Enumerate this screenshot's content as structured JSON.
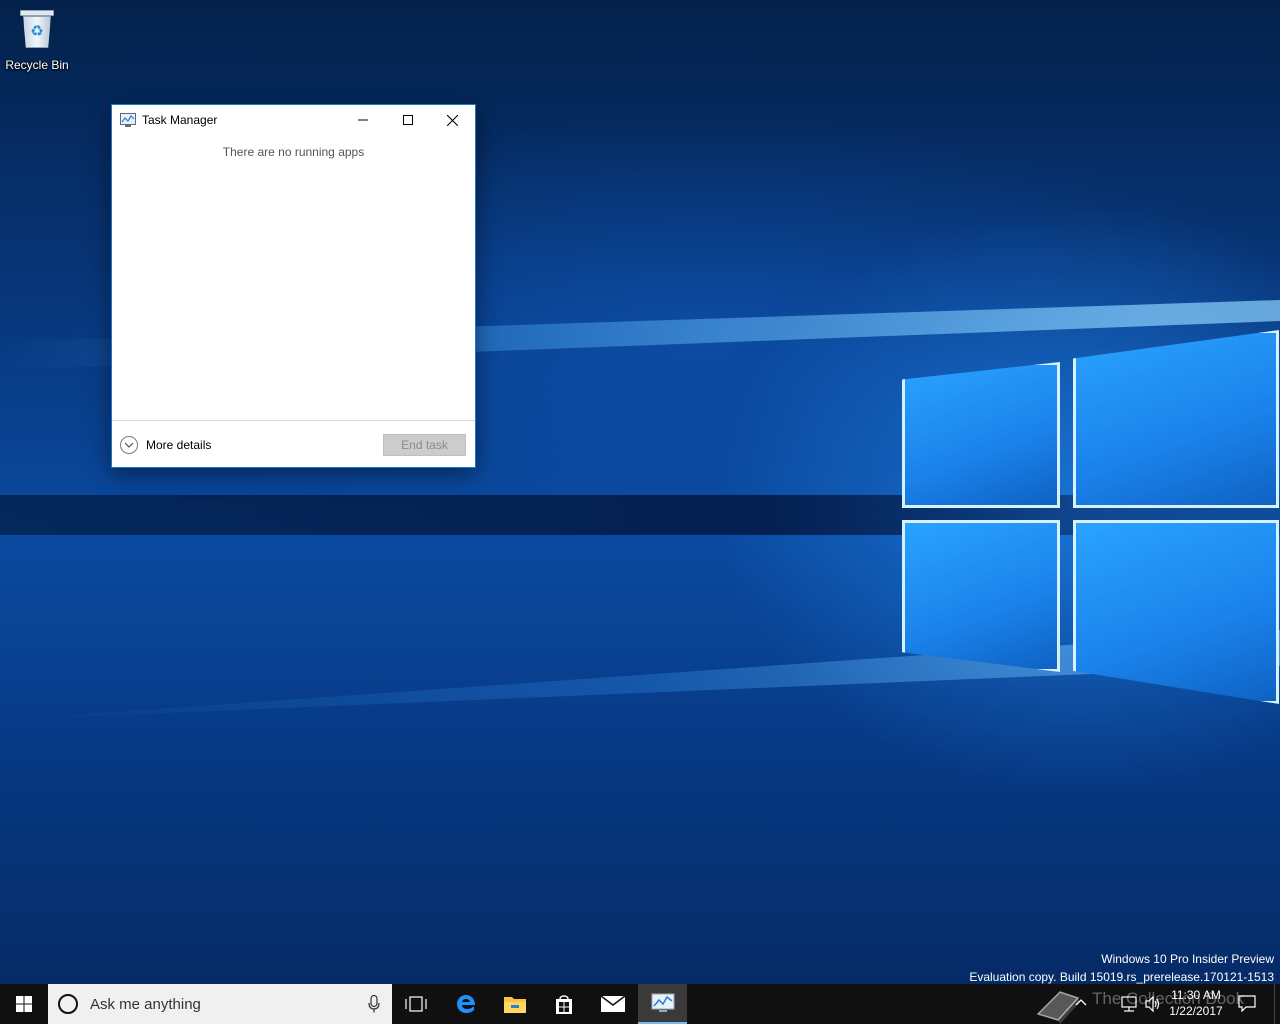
{
  "desktop": {
    "icons": [
      {
        "label": "Recycle Bin",
        "icon": "recycle-bin-icon"
      }
    ],
    "watermark": {
      "line1": "Windows 10 Pro Insider Preview",
      "line2": "Evaluation copy. Build 15019.rs_prerelease.170121-1513"
    }
  },
  "task_manager": {
    "title": "Task Manager",
    "empty_message": "There are no running apps",
    "more_details_label": "More details",
    "end_task_label": "End task",
    "end_task_enabled": false
  },
  "taskbar": {
    "search_placeholder": "Ask me anything",
    "pinned": [
      "task-view-icon",
      "edge-icon",
      "file-explorer-icon",
      "store-icon",
      "mail-icon",
      "task-manager-icon"
    ],
    "active_app": "Task Manager",
    "accent_color": "#76b9ed",
    "overlay_text": "The Collection Book",
    "clock": {
      "time": "11:30 AM",
      "date": "1/22/2017"
    }
  }
}
